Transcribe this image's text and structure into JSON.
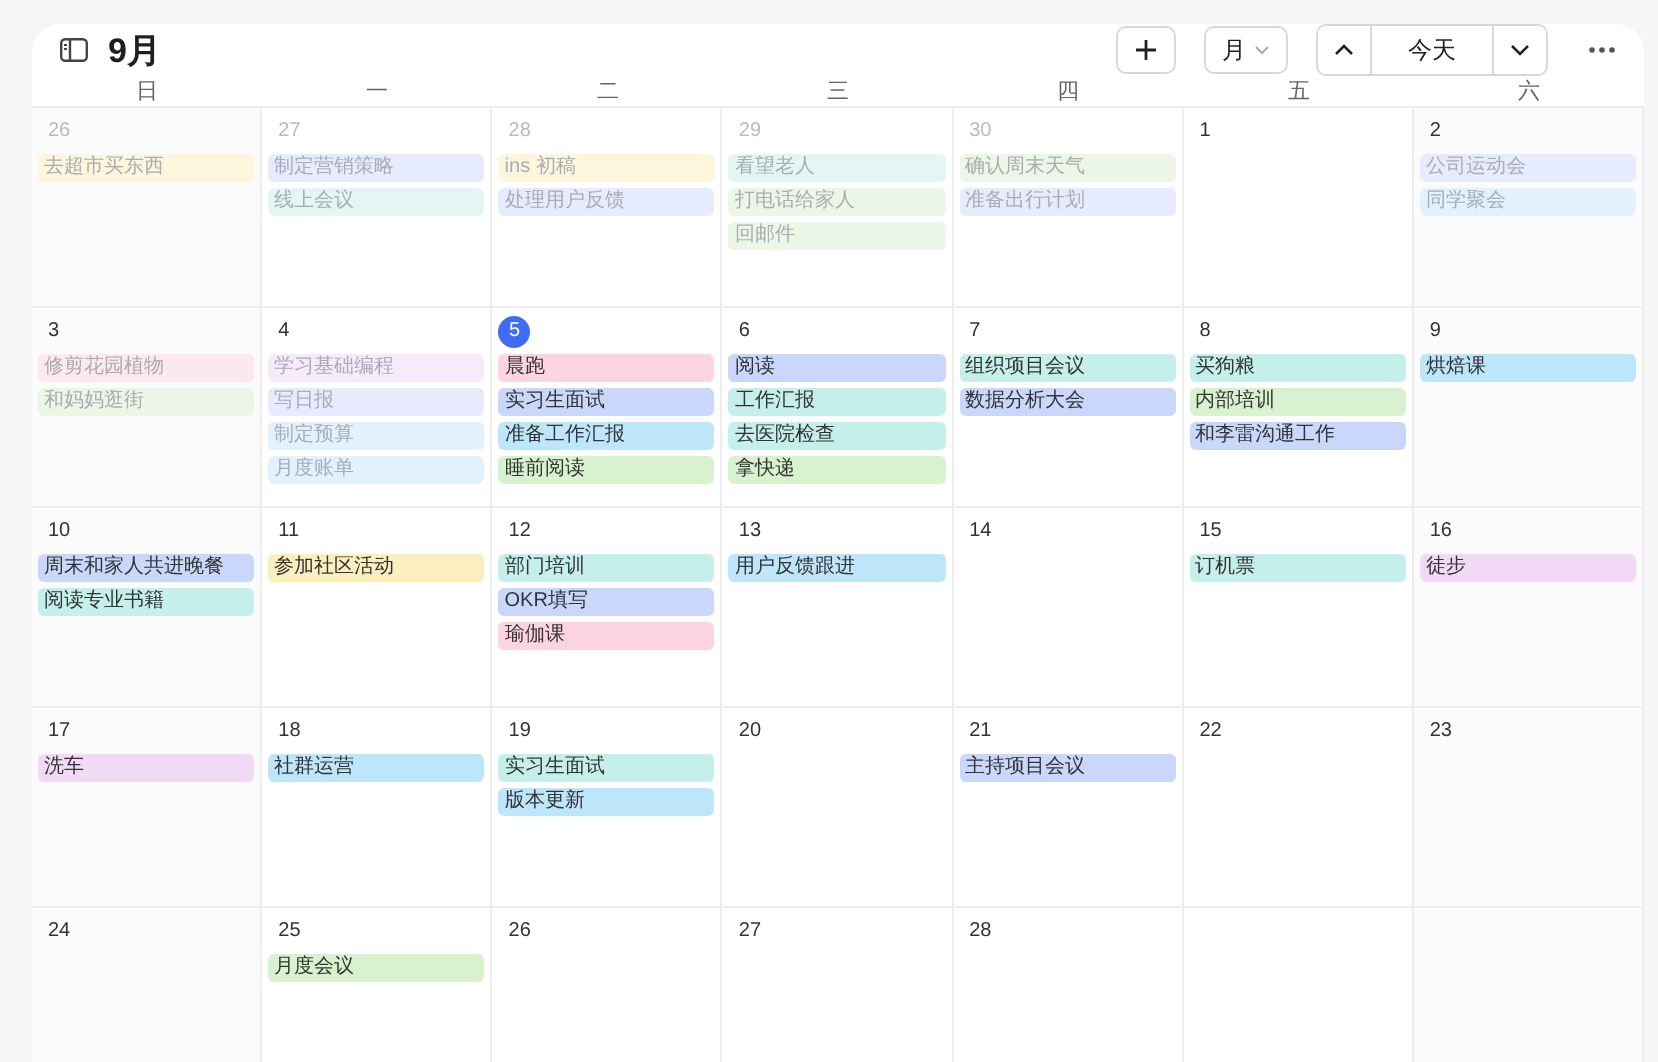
{
  "header": {
    "title": "9月",
    "view": "月",
    "today_button": "今天"
  },
  "weekdays": [
    "日",
    "一",
    "二",
    "三",
    "四",
    "五",
    "六"
  ],
  "weeks": [
    [
      {
        "number": "26",
        "other_month": true,
        "past": true,
        "events": [
          {
            "title": "去超市买东西",
            "color": "#fdf6dc"
          }
        ]
      },
      {
        "number": "27",
        "other_month": true,
        "past": true,
        "events": [
          {
            "title": "制定营销策略",
            "color": "#e6ebfd"
          },
          {
            "title": "线上会议",
            "color": "#e3f6f3"
          }
        ]
      },
      {
        "number": "28",
        "other_month": true,
        "past": true,
        "events": [
          {
            "title": "ins 初稿",
            "color": "#fdf6dc"
          },
          {
            "title": "处理用户反馈",
            "color": "#e6ebfd"
          }
        ]
      },
      {
        "number": "29",
        "other_month": true,
        "past": true,
        "events": [
          {
            "title": "看望老人",
            "color": "#e3f6f3"
          },
          {
            "title": "打电话给家人",
            "color": "#ebf6e6"
          },
          {
            "title": "回邮件",
            "color": "#ebf6e6"
          }
        ]
      },
      {
        "number": "30",
        "other_month": true,
        "past": true,
        "events": [
          {
            "title": "确认周末天气",
            "color": "#ebf6e6"
          },
          {
            "title": "准备出行计划",
            "color": "#e6ebfd"
          }
        ]
      },
      {
        "number": "1"
      },
      {
        "number": "2",
        "past": true,
        "events": [
          {
            "title": "公司运动会",
            "color": "#e6ebfd"
          },
          {
            "title": "同学聚会",
            "color": "#e2f2fc"
          }
        ]
      }
    ],
    [
      {
        "number": "3",
        "past": true,
        "events": [
          {
            "title": "修剪花园植物",
            "color": "#fde8ee"
          },
          {
            "title": "和妈妈逛街",
            "color": "#ebf6e6"
          }
        ]
      },
      {
        "number": "4",
        "past": true,
        "events": [
          {
            "title": "学习基础编程",
            "color": "#f6eafb"
          },
          {
            "title": "写日报",
            "color": "#e6ebfd"
          },
          {
            "title": "制定预算",
            "color": "#e2f2fc"
          },
          {
            "title": "月度账单",
            "color": "#e2f2fc"
          }
        ]
      },
      {
        "number": "5",
        "today": true,
        "events": [
          {
            "title": "晨跑",
            "color": "#fdd5e0"
          },
          {
            "title": "实习生面试",
            "color": "#c9d7fb"
          },
          {
            "title": "准备工作汇报",
            "color": "#bde6fb"
          },
          {
            "title": "睡前阅读",
            "color": "#d8f2cf"
          }
        ]
      },
      {
        "number": "6",
        "events": [
          {
            "title": "阅读",
            "color": "#c9d7fb"
          },
          {
            "title": "工作汇报",
            "color": "#c4efea"
          },
          {
            "title": "去医院检查",
            "color": "#c4efea"
          },
          {
            "title": "拿快递",
            "color": "#d8f2cf"
          }
        ]
      },
      {
        "number": "7",
        "events": [
          {
            "title": "组织项目会议",
            "color": "#c4efea"
          },
          {
            "title": "数据分析大会",
            "color": "#c9d7fb"
          }
        ]
      },
      {
        "number": "8",
        "events": [
          {
            "title": "买狗粮",
            "color": "#c4efea"
          },
          {
            "title": "内部培训",
            "color": "#d8f2cf"
          },
          {
            "title": "和李雷沟通工作",
            "color": "#c9d7fb"
          }
        ]
      },
      {
        "number": "9",
        "events": [
          {
            "title": "烘焙课",
            "color": "#bde6fb"
          }
        ]
      }
    ],
    [
      {
        "number": "10",
        "events": [
          {
            "title": "周末和家人共进晚餐",
            "color": "#c9d7fb"
          },
          {
            "title": "阅读专业书籍",
            "color": "#c4efea"
          }
        ]
      },
      {
        "number": "11",
        "events": [
          {
            "title": "参加社区活动",
            "color": "#fcefbe"
          }
        ]
      },
      {
        "number": "12",
        "events": [
          {
            "title": "部门培训",
            "color": "#c4efea"
          },
          {
            "title": "OKR填写",
            "color": "#c9d7fb"
          },
          {
            "title": "瑜伽课",
            "color": "#fdd5e0"
          }
        ]
      },
      {
        "number": "13",
        "events": [
          {
            "title": "用户反馈跟进",
            "color": "#bde6fb"
          }
        ]
      },
      {
        "number": "14"
      },
      {
        "number": "15",
        "events": [
          {
            "title": "订机票",
            "color": "#c4efea"
          }
        ]
      },
      {
        "number": "16",
        "events": [
          {
            "title": "徒步",
            "color": "#f2d9f6"
          }
        ]
      }
    ],
    [
      {
        "number": "17",
        "events": [
          {
            "title": "洗车",
            "color": "#f2d9f6"
          }
        ]
      },
      {
        "number": "18",
        "events": [
          {
            "title": "社群运营",
            "color": "#bde6fb"
          }
        ]
      },
      {
        "number": "19",
        "events": [
          {
            "title": "实习生面试",
            "color": "#c4efea"
          },
          {
            "title": "版本更新",
            "color": "#bde6fb"
          }
        ]
      },
      {
        "number": "20"
      },
      {
        "number": "21",
        "events": [
          {
            "title": "主持项目会议",
            "color": "#c9d7fb"
          }
        ]
      },
      {
        "number": "22"
      },
      {
        "number": "23"
      }
    ],
    [
      {
        "number": "24"
      },
      {
        "number": "25",
        "events": [
          {
            "title": "月度会议",
            "color": "#d8f2cf"
          }
        ]
      },
      {
        "number": "26"
      },
      {
        "number": "27"
      },
      {
        "number": "28"
      }
    ]
  ]
}
